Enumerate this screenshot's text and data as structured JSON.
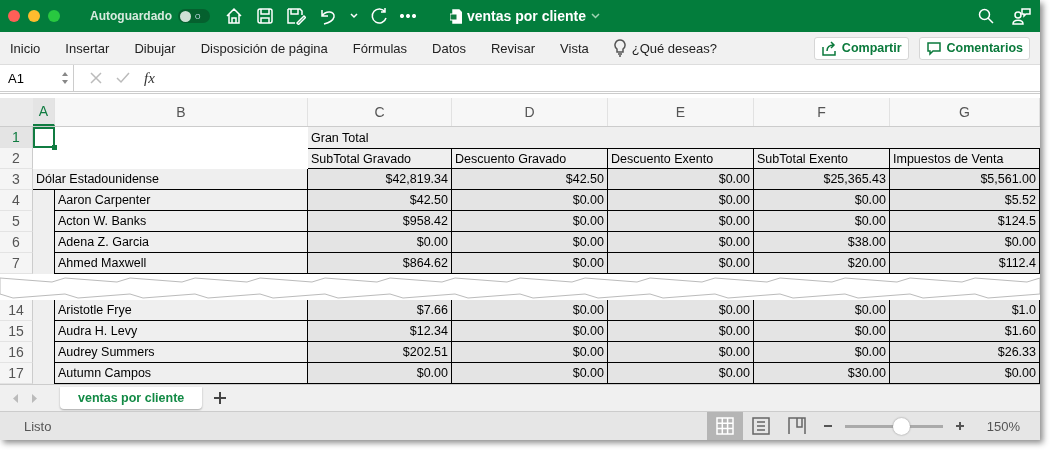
{
  "window": {
    "title": "ventas por cliente",
    "autosave_label": "Autoguardado",
    "autosave": {
      "on": false,
      "text": "O"
    }
  },
  "ribbon": {
    "tabs": [
      {
        "label": "Inicio"
      },
      {
        "label": "Insertar"
      },
      {
        "label": "Dibujar"
      },
      {
        "label": "Disposición de página"
      },
      {
        "label": "Fórmulas"
      },
      {
        "label": "Datos"
      },
      {
        "label": "Revisar"
      },
      {
        "label": "Vista"
      }
    ],
    "tell_me": "¿Qué deseas?",
    "buttons": [
      {
        "kind": "share",
        "label": "Compartir"
      },
      {
        "kind": "comments",
        "label": "Comentarios"
      }
    ]
  },
  "formula_bar": {
    "name_box": "A1",
    "fx": "fx"
  },
  "sheet": {
    "columns": [
      {
        "label": "A",
        "selected": true
      },
      {
        "label": "B",
        "selected": false
      },
      {
        "label": "C",
        "selected": false
      },
      {
        "label": "D",
        "selected": false
      },
      {
        "label": "E",
        "selected": false
      },
      {
        "label": "F",
        "selected": false
      },
      {
        "label": "G",
        "selected": false
      }
    ],
    "sections": [
      {
        "rows": [
          {
            "num": "1",
            "selected": true,
            "kind": "title",
            "title": "Gran Total"
          },
          {
            "num": "2",
            "selected": false,
            "kind": "header",
            "cells": [
              "SubTotal Gravado",
              "Descuento Gravado",
              "Descuento Exento",
              "SubTotal Exento",
              "Impuestos de Venta"
            ]
          },
          {
            "num": "3",
            "selected": false,
            "kind": "currency",
            "name": "Dólar Estadounidense",
            "cells": [
              "$42,819.34",
              "$42.50",
              "$0.00",
              "$25,365.43",
              "$5,561.00"
            ]
          },
          {
            "num": "4",
            "selected": false,
            "kind": "customer",
            "name": "Aaron Carpenter",
            "cells": [
              "$42.50",
              "$0.00",
              "$0.00",
              "$0.00",
              "$5.52"
            ]
          },
          {
            "num": "5",
            "selected": false,
            "kind": "customer",
            "name": "Acton W. Banks",
            "cells": [
              "$958.42",
              "$0.00",
              "$0.00",
              "$0.00",
              "$124.5"
            ]
          },
          {
            "num": "6",
            "selected": false,
            "kind": "customer",
            "name": "Adena Z. Garcia",
            "cells": [
              "$0.00",
              "$0.00",
              "$0.00",
              "$38.00",
              "$0.00"
            ]
          },
          {
            "num": "7",
            "selected": false,
            "kind": "customer",
            "name": "Ahmed Maxwell",
            "cells": [
              "$864.62",
              "$0.00",
              "$0.00",
              "$20.00",
              "$112.4"
            ]
          }
        ]
      },
      {
        "rows": [
          {
            "num": "14",
            "selected": false,
            "kind": "customer",
            "name": "Aristotle Frye",
            "cells": [
              "$7.66",
              "$0.00",
              "$0.00",
              "$0.00",
              "$1.0"
            ]
          },
          {
            "num": "15",
            "selected": false,
            "kind": "customer",
            "name": "Audra H. Levy",
            "cells": [
              "$12.34",
              "$0.00",
              "$0.00",
              "$0.00",
              "$1.60"
            ]
          },
          {
            "num": "16",
            "selected": false,
            "kind": "customer",
            "name": "Audrey Summers",
            "cells": [
              "$202.51",
              "$0.00",
              "$0.00",
              "$0.00",
              "$26.33"
            ]
          },
          {
            "num": "17",
            "selected": false,
            "kind": "customer",
            "name": "Autumn Campos",
            "cells": [
              "$0.00",
              "$0.00",
              "$0.00",
              "$30.00",
              "$0.00"
            ]
          }
        ]
      }
    ],
    "tabs": [
      {
        "label": "ventas por cliente",
        "selected": true
      }
    ]
  },
  "status_bar": {
    "status": "Listo",
    "views": [
      {
        "kind": "normal",
        "selected": true
      },
      {
        "kind": "page-layout",
        "selected": false
      },
      {
        "kind": "page-break",
        "selected": false
      }
    ],
    "zoom": {
      "level": 0.57,
      "label": "150%"
    }
  }
}
